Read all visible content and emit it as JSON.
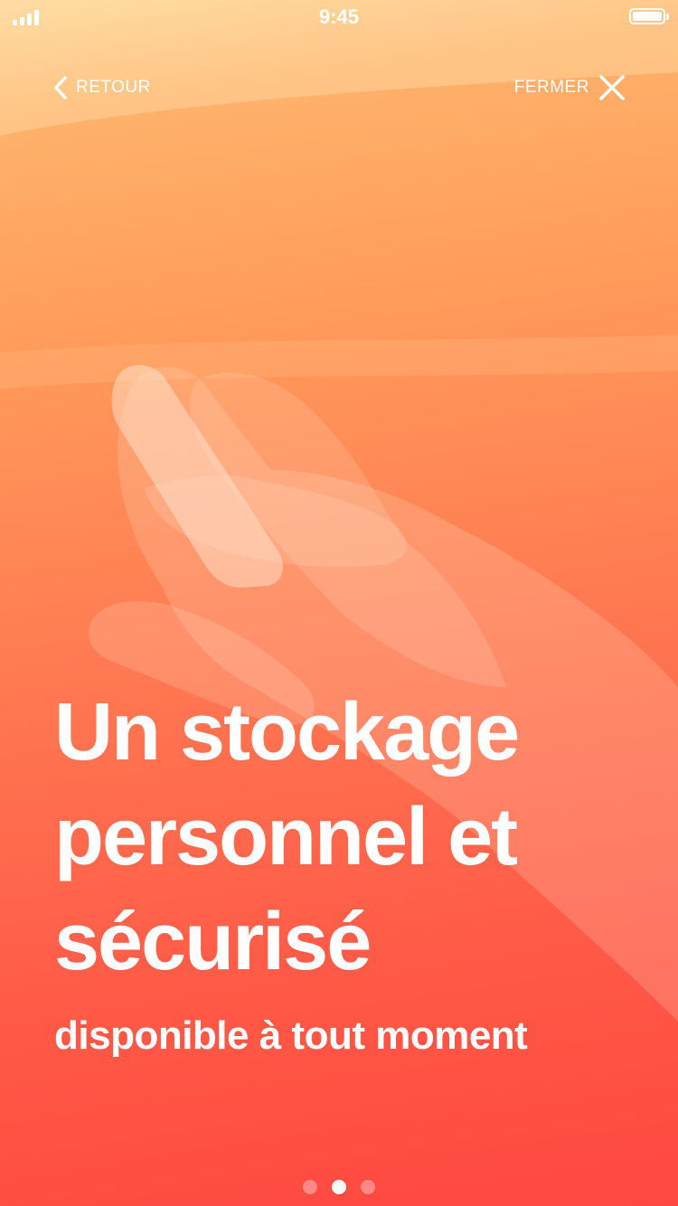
{
  "status_bar": {
    "time": "9:45",
    "icons": [
      "signal-icon",
      "battery-icon"
    ]
  },
  "nav": {
    "back_label": "RETOUR",
    "back_icon": "chevron-left-icon",
    "close_label": "FERMER",
    "close_icon": "close-icon"
  },
  "hero": {
    "title_lines": [
      "Un stockage",
      "personnel et",
      "sécurisé"
    ],
    "subtitle": "disponible à tout moment"
  },
  "pager": {
    "total": 3,
    "active": 2
  },
  "colors": {
    "gradient_top": "#ffd79a",
    "gradient_mid": "#ff9a5a",
    "gradient_bottom": "#ff4740",
    "text": "#ffffff"
  }
}
